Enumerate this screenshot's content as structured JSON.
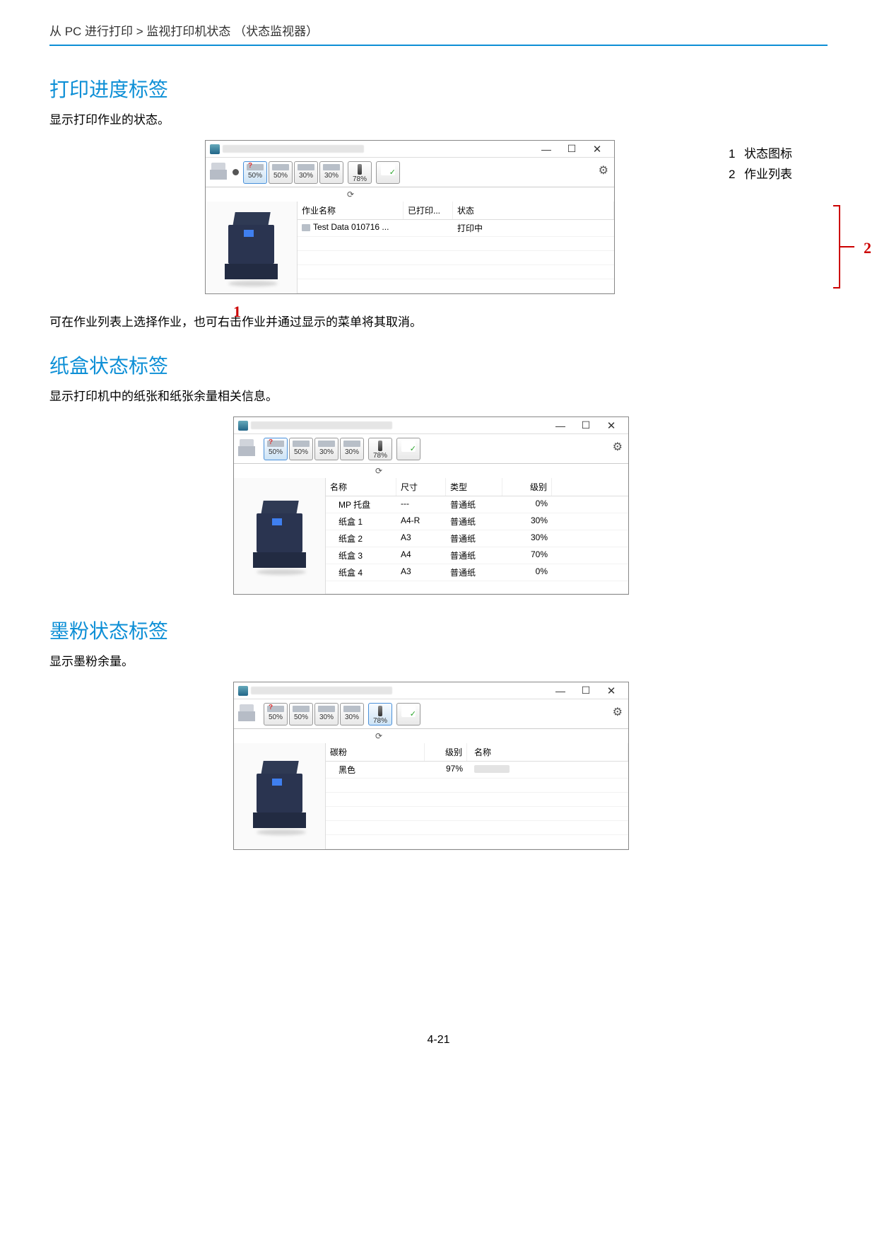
{
  "breadcrumb": "从 PC 进行打印 > 监视打印机状态 （状态监视器）",
  "page_number": "4-21",
  "legend": {
    "i1_num": "1",
    "i1_label": "状态图标",
    "i2_num": "2",
    "i2_label": "作业列表"
  },
  "section1": {
    "title": "打印进度标签",
    "desc": "显示打印作业的状态。",
    "note": "可在作业列表上选择作业，也可右击作业并通过显示的菜单将其取消。"
  },
  "section2": {
    "title": "纸盒状态标签",
    "desc": "显示打印机中的纸张和纸张余量相关信息。"
  },
  "section3": {
    "title": "墨粉状态标签",
    "desc": "显示墨粉余量。"
  },
  "toolbar": {
    "t1": "50%",
    "t2": "50%",
    "t3": "30%",
    "t4": "30%",
    "t5": "78%"
  },
  "progress": {
    "col_name": "作业名称",
    "col_printed": "已打印...",
    "col_status": "状态",
    "row1_name": "Test Data 010716 ...",
    "row1_status": "打印中"
  },
  "cassette": {
    "col_name": "名称",
    "col_size": "尺寸",
    "col_type": "类型",
    "col_level": "级别",
    "r1_name": "MP 托盘",
    "r1_size": "---",
    "r1_type": "普通纸",
    "r1_level": "0%",
    "r2_name": "纸盒 1",
    "r2_size": "A4-R",
    "r2_type": "普通纸",
    "r2_level": "30%",
    "r3_name": "纸盒 2",
    "r3_size": "A3",
    "r3_type": "普通纸",
    "r3_level": "30%",
    "r4_name": "纸盒 3",
    "r4_size": "A4",
    "r4_type": "普通纸",
    "r4_level": "70%",
    "r5_name": "纸盒 4",
    "r5_size": "A3",
    "r5_type": "普通纸",
    "r5_level": "0%"
  },
  "toner": {
    "col_toner": "碳粉",
    "col_level": "级别",
    "col_name": "名称",
    "r1_color": "黑色",
    "r1_level": "97%"
  },
  "callouts": {
    "c1": "1",
    "c2": "2"
  }
}
